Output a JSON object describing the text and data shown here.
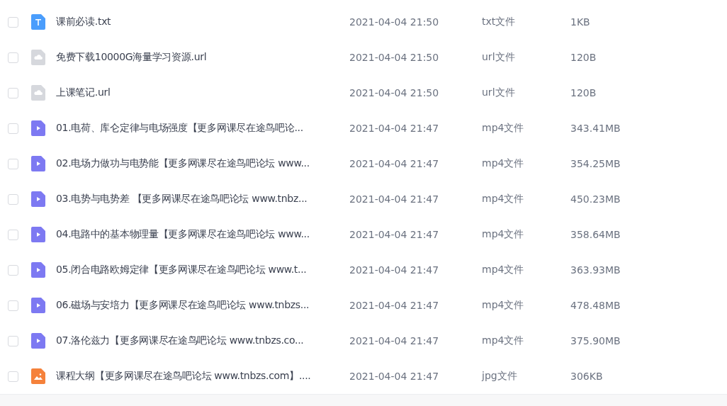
{
  "files": [
    {
      "kind": "text",
      "name": "课前必读.txt",
      "modified": "2021-04-04 21:50",
      "type": "txt文件",
      "size": "1KB",
      "checked": false
    },
    {
      "kind": "link",
      "name": "免费下载10000G海量学习资源.url",
      "modified": "2021-04-04 21:50",
      "type": "url文件",
      "size": "120B",
      "checked": false
    },
    {
      "kind": "link",
      "name": "上课笔记.url",
      "modified": "2021-04-04 21:50",
      "type": "url文件",
      "size": "120B",
      "checked": false
    },
    {
      "kind": "video",
      "name": "01.电荷、库仑定律与电场强度【更多网课尽在途鸟吧论...",
      "modified": "2021-04-04 21:47",
      "type": "mp4文件",
      "size": "343.41MB",
      "checked": false
    },
    {
      "kind": "video",
      "name": "02.电场力做功与电势能【更多网课尽在途鸟吧论坛 www...",
      "modified": "2021-04-04 21:47",
      "type": "mp4文件",
      "size": "354.25MB",
      "checked": false
    },
    {
      "kind": "video",
      "name": "03.电势与电势差 【更多网课尽在途鸟吧论坛 www.tnbz...",
      "modified": "2021-04-04 21:47",
      "type": "mp4文件",
      "size": "450.23MB",
      "checked": false
    },
    {
      "kind": "video",
      "name": "04.电路中的基本物理量【更多网课尽在途鸟吧论坛 www...",
      "modified": "2021-04-04 21:47",
      "type": "mp4文件",
      "size": "358.64MB",
      "checked": false
    },
    {
      "kind": "video",
      "name": "05.闭合电路欧姆定律【更多网课尽在途鸟吧论坛 www.t...",
      "modified": "2021-04-04 21:47",
      "type": "mp4文件",
      "size": "363.93MB",
      "checked": false
    },
    {
      "kind": "video",
      "name": "06.磁场与安培力【更多网课尽在途鸟吧论坛 www.tnbzs...",
      "modified": "2021-04-04 21:47",
      "type": "mp4文件",
      "size": "478.48MB",
      "checked": false
    },
    {
      "kind": "video",
      "name": "07.洛伦兹力【更多网课尽在途鸟吧论坛 www.tnbzs.co...",
      "modified": "2021-04-04 21:47",
      "type": "mp4文件",
      "size": "375.90MB",
      "checked": false
    },
    {
      "kind": "image",
      "name": "课程大纲【更多网课尽在途鸟吧论坛 www.tnbzs.com】....",
      "modified": "2021-04-04 21:47",
      "type": "jpg文件",
      "size": "306KB",
      "checked": false
    }
  ]
}
